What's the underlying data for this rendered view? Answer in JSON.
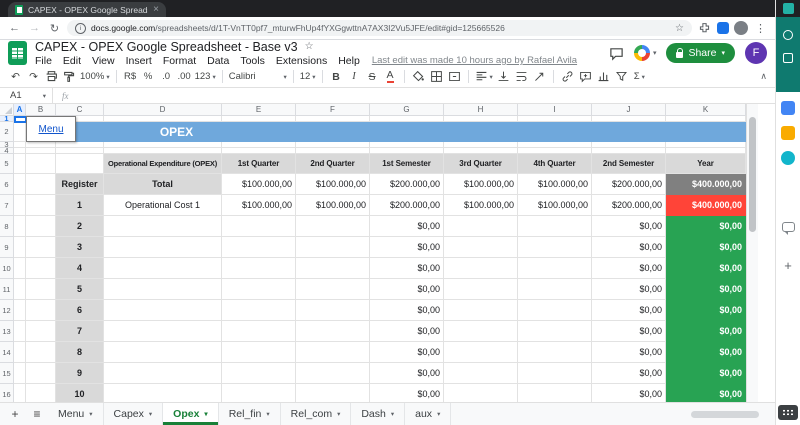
{
  "browser": {
    "tab_title": "CAPEX - OPEX Google Spreadsh",
    "url_domain": "docs.google.com",
    "url_path": "/spreadsheets/d/1T-VnTT0pf7_mturwFhUp4fYXGgwttnA7AX3I2Vu5JFE/edit#gid=125665526"
  },
  "app": {
    "title": "CAPEX - OPEX Google Spreadsheet - Base v3",
    "menus": [
      "File",
      "Edit",
      "View",
      "Insert",
      "Format",
      "Data",
      "Tools",
      "Extensions",
      "Help"
    ],
    "last_edit": "Last edit was made 10 hours ago by Rafael Avila",
    "share_label": "Share",
    "avatar_letter": "F"
  },
  "toolbar": {
    "zoom": "100%",
    "currency": "R$",
    "percent": "%",
    "decimal_decrease": ".0",
    "decimal_increase": ".00",
    "more_formats": "123",
    "font": "Calibri",
    "font_size": "12"
  },
  "formula_bar": {
    "name_box": "A1",
    "fx_label": "fx"
  },
  "icons": {
    "back": "←",
    "forward": "→",
    "reload": "↻",
    "star": "☆",
    "menu_dots": "⋮",
    "undo": "↶",
    "redo": "↷",
    "dropdown": "▾",
    "bold": "B",
    "italic": "I",
    "strikethrough": "S",
    "text_color": "A",
    "sigma": "Σ",
    "add": "+",
    "all_sheets": "≡",
    "collapse": "∧",
    "close": "×"
  },
  "grid": {
    "col_letters": [
      "A",
      "B",
      "C",
      "D",
      "E",
      "F",
      "G",
      "H",
      "I",
      "J",
      "K"
    ],
    "row_numbers": [
      1,
      2,
      3,
      4,
      5,
      6,
      7,
      8,
      9,
      10,
      11,
      12,
      13,
      14,
      15,
      16
    ],
    "banner": {
      "menu_label": "Menu",
      "title": "OPEX"
    },
    "table": {
      "headers": [
        "Operational Expenditure (OPEX)",
        "1st Quarter",
        "2nd Quarter",
        "1st Semester",
        "3rd Quarter",
        "4th Quarter",
        "2nd Semester",
        "Year"
      ],
      "register_label": "Register",
      "total_row": {
        "label": "Total",
        "values": [
          "$100.000,00",
          "$100.000,00",
          "$200.000,00",
          "$100.000,00",
          "$100.000,00",
          "$200.000,00"
        ],
        "year": "$400.000,00"
      },
      "rows": [
        {
          "register": "1",
          "name": "Operational Cost 1",
          "values": [
            "$100.000,00",
            "$100.000,00",
            "$200.000,00",
            "$100.000,00",
            "$100.000,00",
            "$200.000,00"
          ],
          "year": "$400.000,00",
          "year_style": "red"
        },
        {
          "register": "2",
          "name": "",
          "values": [
            "",
            "",
            "$0,00",
            "",
            "",
            "$0,00"
          ],
          "year": "$0,00",
          "year_style": "green"
        },
        {
          "register": "3",
          "name": "",
          "values": [
            "",
            "",
            "$0,00",
            "",
            "",
            "$0,00"
          ],
          "year": "$0,00",
          "year_style": "green"
        },
        {
          "register": "4",
          "name": "",
          "values": [
            "",
            "",
            "$0,00",
            "",
            "",
            "$0,00"
          ],
          "year": "$0,00",
          "year_style": "green"
        },
        {
          "register": "5",
          "name": "",
          "values": [
            "",
            "",
            "$0,00",
            "",
            "",
            "$0,00"
          ],
          "year": "$0,00",
          "year_style": "green"
        },
        {
          "register": "6",
          "name": "",
          "values": [
            "",
            "",
            "$0,00",
            "",
            "",
            "$0,00"
          ],
          "year": "$0,00",
          "year_style": "green"
        },
        {
          "register": "7",
          "name": "",
          "values": [
            "",
            "",
            "$0,00",
            "",
            "",
            "$0,00"
          ],
          "year": "$0,00",
          "year_style": "green"
        },
        {
          "register": "8",
          "name": "",
          "values": [
            "",
            "",
            "$0,00",
            "",
            "",
            "$0,00"
          ],
          "year": "$0,00",
          "year_style": "green"
        },
        {
          "register": "9",
          "name": "",
          "values": [
            "",
            "",
            "$0,00",
            "",
            "",
            "$0,00"
          ],
          "year": "$0,00",
          "year_style": "green"
        },
        {
          "register": "10",
          "name": "",
          "values": [
            "",
            "",
            "$0,00",
            "",
            "",
            "$0,00"
          ],
          "year": "$0,00",
          "year_style": "green"
        }
      ]
    }
  },
  "sheet_tabs": {
    "items": [
      "Menu",
      "Capex",
      "Opex",
      "Rel_fin",
      "Rel_com",
      "Dash",
      "aux"
    ],
    "active_index": 2
  },
  "colors": {
    "banner_blue": "#6fa8dc",
    "header_gray": "#d9d9d9",
    "year_gray": "#808080",
    "year_red": "#ff4438",
    "year_green": "#28a353",
    "share_green": "#1e8e3e",
    "tab_active_green": "#188038",
    "logo_green": "#0f9d58",
    "sidebar_teal": "#0f7a6f",
    "accent_blue": "#1a73e8",
    "link_blue": "#1155cc"
  }
}
